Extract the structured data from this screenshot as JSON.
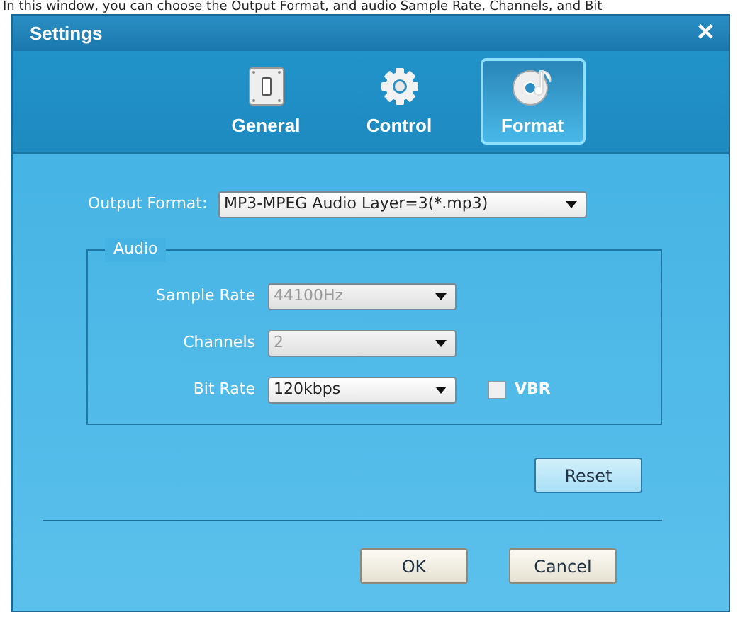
{
  "caption": "In this window, you can choose the Output Format, and audio Sample Rate, Channels, and Bit",
  "window": {
    "title": "Settings",
    "close": "✕"
  },
  "tabs": [
    {
      "label": "General",
      "selected": false
    },
    {
      "label": "Control",
      "selected": false
    },
    {
      "label": "Format",
      "selected": true
    }
  ],
  "output_format": {
    "label": "Output Format:",
    "value": "MP3-MPEG Audio Layer=3(*.mp3)"
  },
  "audio": {
    "title": "Audio",
    "fields": [
      {
        "label": "Sample Rate",
        "value": "44100Hz",
        "disabled": true
      },
      {
        "label": "Channels",
        "value": "2",
        "disabled": true
      },
      {
        "label": "Bit Rate",
        "value": "120kbps",
        "disabled": false
      }
    ],
    "vbr": {
      "label": "VBR",
      "checked": false
    }
  },
  "buttons": {
    "reset": "Reset",
    "ok": "OK",
    "cancel": "Cancel"
  }
}
